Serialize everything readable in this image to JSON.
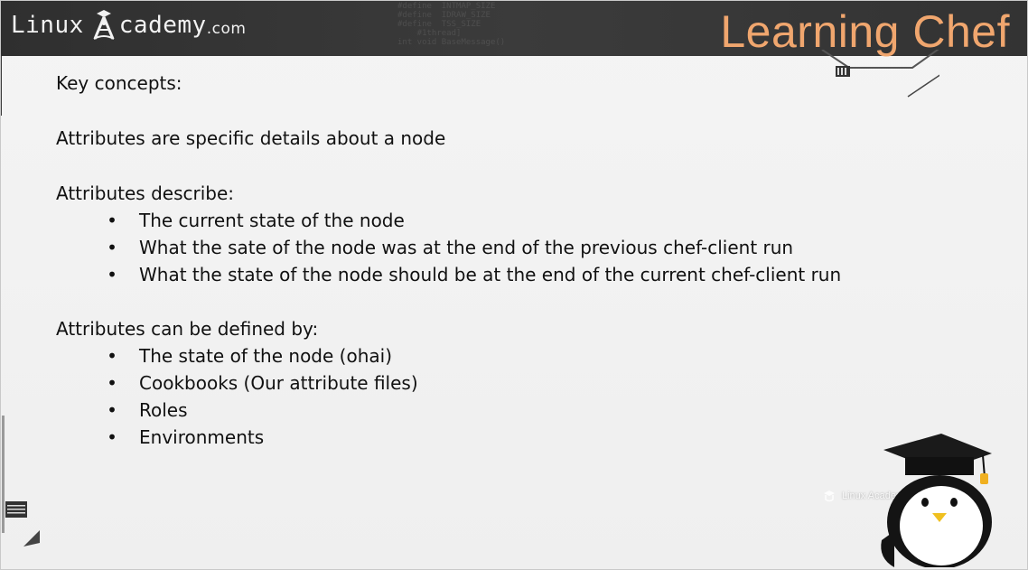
{
  "header": {
    "brand_left": "Linux",
    "brand_right": "cademy",
    "brand_suffix": ".com",
    "title": "Learning Chef",
    "code_texts": [
      "#define  INTMAP_SIZE   ",
      "#define  IDRAW_SIZE",
      "#define  TSS_SIZE",
      "    #1thread]",
      "int void BaseMessage()"
    ]
  },
  "content": {
    "heading": "Key concepts:",
    "definition": "Attributes are specific details about a node",
    "describe": {
      "label": "Attributes describe:",
      "items": [
        "The current state of the node",
        "What the sate of the node was at the end of the previous chef-client run",
        "What the state of the node should be at the end of the current chef-client run"
      ]
    },
    "defined_by": {
      "label": "Attributes can be defined by:",
      "items": [
        "The state of the node (ohai)",
        "Cookbooks (Our attribute files)",
        "Roles",
        "Environments"
      ]
    },
    "bullet_char": "•"
  },
  "watermark": {
    "text": "Linux Academy"
  },
  "colors": {
    "title": "#f0a66e",
    "header_bg": "#333333",
    "text": "#111111"
  },
  "icons": [
    "linux-academy-logo-icon",
    "penguin-mascot-icon",
    "watermark-logo-icon"
  ]
}
